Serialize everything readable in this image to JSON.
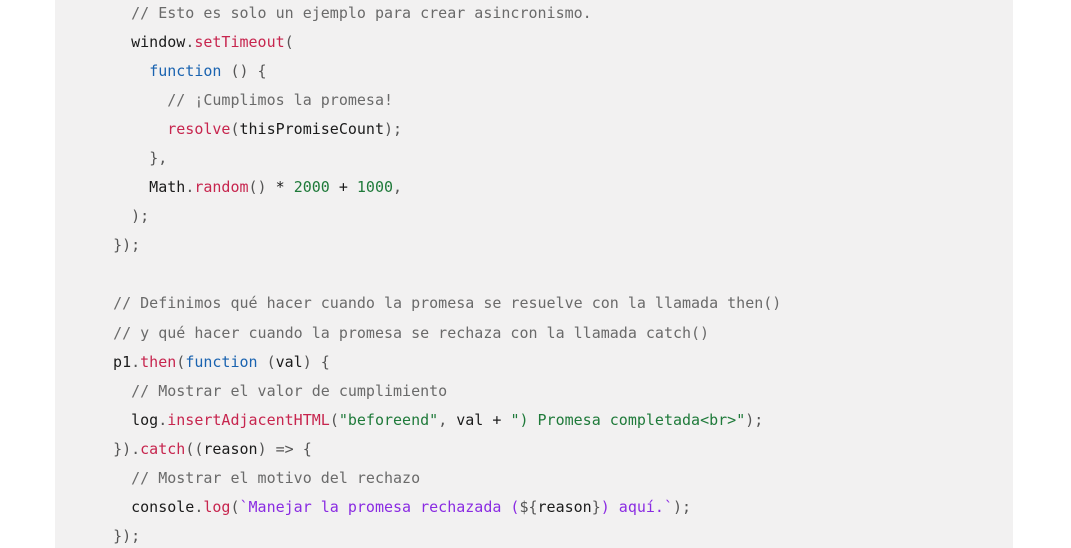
{
  "code_lines": [
    [
      [
        "    ",
        "plain"
      ],
      [
        "// Esto es solo un ejemplo para crear asincronismo.",
        "comment"
      ]
    ],
    [
      [
        "    window",
        "plain"
      ],
      [
        ".",
        "punct"
      ],
      [
        "setTimeout",
        "function"
      ],
      [
        "(",
        "punct"
      ]
    ],
    [
      [
        "      ",
        "plain"
      ],
      [
        "function",
        "keyword"
      ],
      [
        " ",
        "plain"
      ],
      [
        "() {",
        "punct"
      ]
    ],
    [
      [
        "        ",
        "plain"
      ],
      [
        "// ¡Cumplimos la promesa!",
        "comment"
      ]
    ],
    [
      [
        "        ",
        "plain"
      ],
      [
        "resolve",
        "function"
      ],
      [
        "(",
        "punct"
      ],
      [
        "thisPromiseCount",
        "plain"
      ],
      [
        ");",
        "punct"
      ]
    ],
    [
      [
        "      ",
        "plain"
      ],
      [
        "},",
        "punct"
      ]
    ],
    [
      [
        "      Math",
        "plain"
      ],
      [
        ".",
        "punct"
      ],
      [
        "random",
        "function"
      ],
      [
        "()",
        "punct"
      ],
      [
        " * ",
        "plain"
      ],
      [
        "2000",
        "number"
      ],
      [
        " + ",
        "plain"
      ],
      [
        "1000",
        "number"
      ],
      [
        ",",
        "punct"
      ]
    ],
    [
      [
        "    ",
        "plain"
      ],
      [
        ");",
        "punct"
      ]
    ],
    [
      [
        "  ",
        "plain"
      ],
      [
        "});",
        "punct"
      ]
    ],
    [
      [
        "",
        "plain"
      ]
    ],
    [
      [
        "  ",
        "plain"
      ],
      [
        "// Definimos qué hacer cuando la promesa se resuelve con la llamada then()",
        "comment"
      ]
    ],
    [
      [
        "  ",
        "plain"
      ],
      [
        "// y qué hacer cuando la promesa se rechaza con la llamada catch()",
        "comment"
      ]
    ],
    [
      [
        "  p1",
        "plain"
      ],
      [
        ".",
        "punct"
      ],
      [
        "then",
        "function"
      ],
      [
        "(",
        "punct"
      ],
      [
        "function",
        "keyword"
      ],
      [
        " ",
        "plain"
      ],
      [
        "(",
        "punct"
      ],
      [
        "val",
        "plain"
      ],
      [
        ") {",
        "punct"
      ]
    ],
    [
      [
        "    ",
        "plain"
      ],
      [
        "// Mostrar el valor de cumplimiento",
        "comment"
      ]
    ],
    [
      [
        "    log",
        "plain"
      ],
      [
        ".",
        "punct"
      ],
      [
        "insertAdjacentHTML",
        "function"
      ],
      [
        "(",
        "punct"
      ],
      [
        "\"beforeend\"",
        "string"
      ],
      [
        ", ",
        "punct"
      ],
      [
        "val",
        "plain"
      ],
      [
        " + ",
        "plain"
      ],
      [
        "\") Promesa completada<br>\"",
        "string"
      ],
      [
        ");",
        "punct"
      ]
    ],
    [
      [
        "  ",
        "plain"
      ],
      [
        "})",
        "punct"
      ],
      [
        ".",
        "punct"
      ],
      [
        "catch",
        "function"
      ],
      [
        "((",
        "punct"
      ],
      [
        "reason",
        "plain"
      ],
      [
        ") => {",
        "punct"
      ]
    ],
    [
      [
        "    ",
        "plain"
      ],
      [
        "// Mostrar el motivo del rechazo",
        "comment"
      ]
    ],
    [
      [
        "    console",
        "plain"
      ],
      [
        ".",
        "punct"
      ],
      [
        "log",
        "function"
      ],
      [
        "(",
        "punct"
      ],
      [
        "`Manejar la promesa rechazada (",
        "template"
      ],
      [
        "${",
        "punct"
      ],
      [
        "reason",
        "plain"
      ],
      [
        "}",
        "punct"
      ],
      [
        ") aquí.`",
        "template"
      ],
      [
        ");",
        "punct"
      ]
    ],
    [
      [
        "  ",
        "plain"
      ],
      [
        "});",
        "punct"
      ]
    ]
  ],
  "colors": {
    "background": "#f2f1f1",
    "comment": "#6a6a6a",
    "keyword": "#1a63b0",
    "function": "#c7254e",
    "string": "#1f7a3a",
    "number": "#1f7a3a",
    "template": "#8a2be2"
  }
}
